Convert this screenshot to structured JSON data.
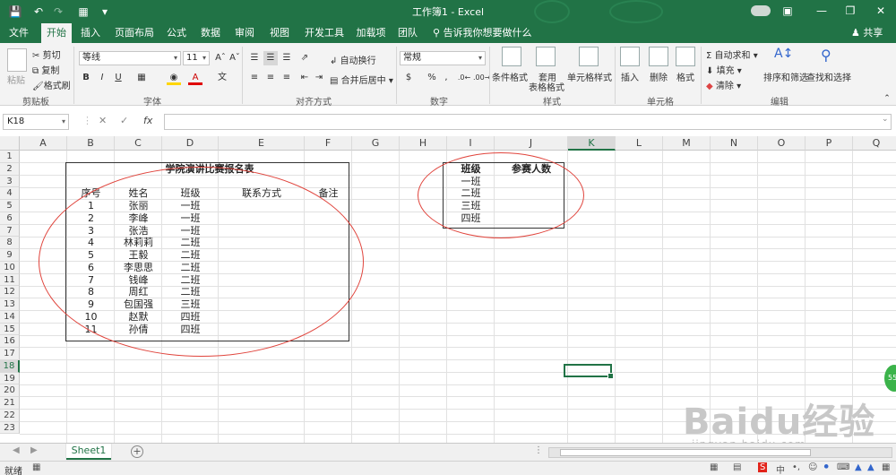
{
  "window": {
    "title": "工作簿1 - Excel",
    "qat_icons": [
      "save-icon",
      "undo-icon",
      "redo-icon",
      "print-preview-icon",
      "customize-qat-icon"
    ],
    "controls": [
      "ribbon-display-icon",
      "minimize-icon",
      "restore-icon",
      "close-icon"
    ]
  },
  "tabs": {
    "items": [
      "文件",
      "开始",
      "插入",
      "页面布局",
      "公式",
      "数据",
      "审阅",
      "视图",
      "开发工具",
      "加载项",
      "团队"
    ],
    "active": "开始",
    "tell_me": "告诉我你想要做什么",
    "share": "共享"
  },
  "ribbon": {
    "clipboard": {
      "paste": "粘贴",
      "cut": "剪切",
      "copy": "复制",
      "format_painter": "格式刷",
      "label": "剪贴板"
    },
    "font": {
      "name": "等线",
      "size": "11",
      "bold": "B",
      "italic": "I",
      "underline": "U",
      "label": "字体"
    },
    "alignment": {
      "wrap": "自动换行",
      "merge": "合并后居中",
      "label": "对齐方式"
    },
    "number": {
      "format": "常规",
      "percent": "%",
      "comma": ",",
      "label": "数字"
    },
    "styles": {
      "conditional": "条件格式",
      "table_l1": "套用",
      "table_l2": "表格格式",
      "cell_styles": "单元格样式",
      "label": "样式"
    },
    "cells": {
      "insert": "插入",
      "delete": "删除",
      "format": "格式",
      "label": "单元格"
    },
    "editing": {
      "autosum": "自动求和",
      "fill": "填充",
      "clear": "清除",
      "sort": "排序和筛选",
      "find": "查找和选择",
      "label": "编辑"
    }
  },
  "formula_bar": {
    "name_box": "K18",
    "cancel": "✕",
    "enter": "✓",
    "fx": "fx",
    "formula": ""
  },
  "grid": {
    "columns": [
      "A",
      "B",
      "C",
      "D",
      "E",
      "F",
      "G",
      "H",
      "I",
      "J",
      "K",
      "L",
      "M",
      "N",
      "O",
      "P",
      "Q"
    ],
    "rows": [
      "1",
      "2",
      "3",
      "4",
      "5",
      "6",
      "7",
      "8",
      "9",
      "10",
      "11",
      "12",
      "13",
      "14",
      "15",
      "16",
      "17",
      "18",
      "19",
      "20",
      "21",
      "22",
      "23"
    ],
    "selected_col": "K",
    "selected_row": "18"
  },
  "table1": {
    "title": "学院演讲比赛报名表",
    "headers": [
      "序号",
      "姓名",
      "班级",
      "联系方式",
      "备注"
    ],
    "rows": [
      [
        "1",
        "张丽",
        "一班"
      ],
      [
        "2",
        "李峰",
        "一班"
      ],
      [
        "3",
        "张浩",
        "一班"
      ],
      [
        "4",
        "林莉莉",
        "二班"
      ],
      [
        "5",
        "王毅",
        "二班"
      ],
      [
        "6",
        "李思思",
        "二班"
      ],
      [
        "7",
        "钱峰",
        "二班"
      ],
      [
        "8",
        "周红",
        "二班"
      ],
      [
        "9",
        "包国强",
        "三班"
      ],
      [
        "10",
        "赵默",
        "四班"
      ],
      [
        "11",
        "孙倩",
        "四班"
      ]
    ]
  },
  "table2": {
    "headers": [
      "班级",
      "参赛人数"
    ],
    "rows": [
      "一班",
      "二班",
      "三班",
      "四班"
    ]
  },
  "sheets": {
    "tabs": [
      "Sheet1"
    ],
    "add": "+"
  },
  "status": {
    "ready": "就绪"
  },
  "watermark": {
    "logo": "Baidu经验",
    "url": "jingyan.baidu.com"
  },
  "colors": {
    "accent": "#217346",
    "annotation": "#e0443c"
  }
}
